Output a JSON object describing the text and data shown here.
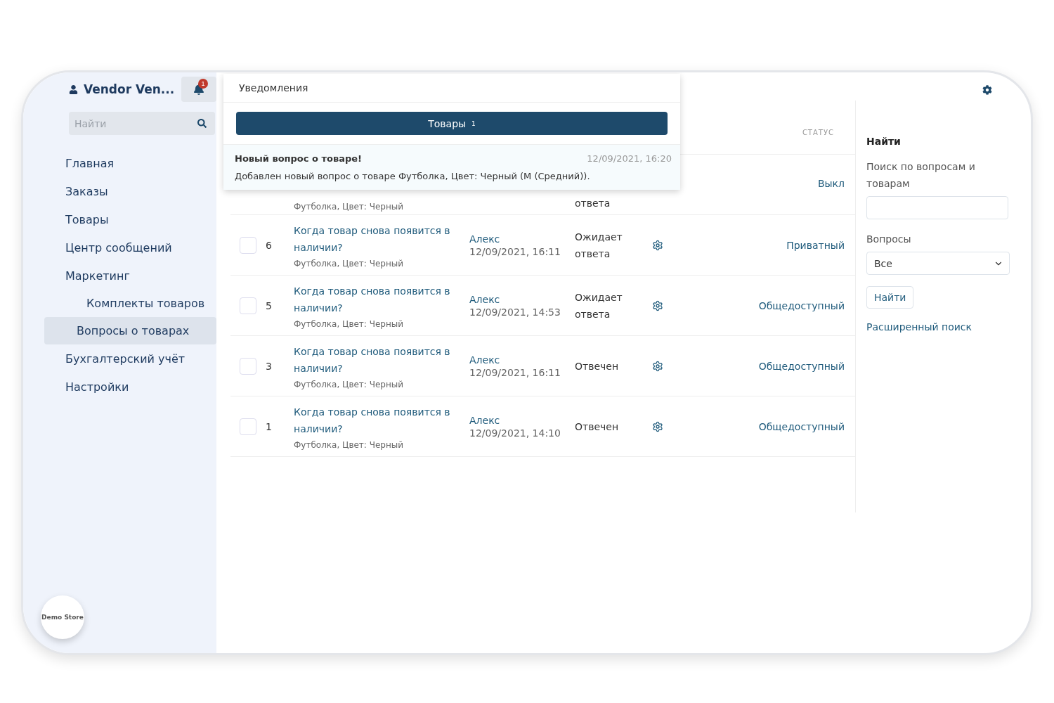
{
  "sidebar": {
    "vendor": "Vendor Ven...",
    "notification_count": "1",
    "search": {
      "placeholder": "Найти"
    },
    "items": [
      {
        "label": "Главная",
        "selected": false
      },
      {
        "label": "Заказы",
        "selected": false
      },
      {
        "label": "Товары",
        "selected": false
      },
      {
        "label": "Центр сообщений",
        "selected": false
      },
      {
        "label": "Маркетинг",
        "selected": false,
        "children": [
          {
            "label": "Комплекты товаров",
            "selected": false
          },
          {
            "label": "Вопросы о товарах",
            "selected": true
          }
        ]
      },
      {
        "label": "Бухгалтерский учёт",
        "selected": false
      },
      {
        "label": "Настройки",
        "selected": false
      }
    ],
    "logo": "Demo Store"
  },
  "notifications": {
    "title": "Уведомления",
    "tab": {
      "label": "Товары",
      "count": "1"
    },
    "items": [
      {
        "title": "Новый вопрос о товаре!",
        "time": "12/09/2021, 16:20",
        "text": "Добавлен новый вопрос о товаре Футболка, Цвет: Черный (M (Средний))."
      }
    ]
  },
  "table": {
    "columns": [
      {
        "label": "СТАТУС"
      }
    ],
    "rows": [
      {
        "kind": "partial",
        "product": "Футболка, Цвет: Черный",
        "status": "ответа",
        "visibility": "Выкл"
      },
      {
        "kind": "full",
        "checked": false,
        "id": "6",
        "question": "Когда товар снова появится в наличии?",
        "product": "Футболка, Цвет: Черный",
        "author": "Алекс",
        "date": "12/09/2021, 16:11",
        "status": "Ожидает ответа",
        "visibility": "Приватный"
      },
      {
        "kind": "full",
        "checked": false,
        "id": "5",
        "question": "Когда товар снова появится в наличии?",
        "product": "Футболка, Цвет: Черный",
        "author": "Алекс",
        "date": "12/09/2021, 14:53",
        "status": "Ожидает ответа",
        "visibility": "Общедоступный"
      },
      {
        "kind": "full",
        "checked": false,
        "id": "3",
        "question": "Когда товар снова появится в наличии?",
        "product": "Футболка, Цвет: Черный",
        "author": "Алекс",
        "date": "12/09/2021, 16:11",
        "status": "Отвечен",
        "visibility": "Общедоступный"
      },
      {
        "kind": "full",
        "checked": false,
        "id": "1",
        "question": "Когда товар снова появится в наличии?",
        "product": "Футболка, Цвет: Черный",
        "author": "Алекс",
        "date": "12/09/2021, 14:10",
        "status": "Отвечен",
        "visibility": "Общедоступный"
      }
    ]
  },
  "filter": {
    "title": "Найти",
    "search_label": "Поиск по вопросам и товарам",
    "questions_label": "Вопросы",
    "questions_value": "Все",
    "button": "Найти",
    "advanced_link": "Расширенный поиск"
  }
}
